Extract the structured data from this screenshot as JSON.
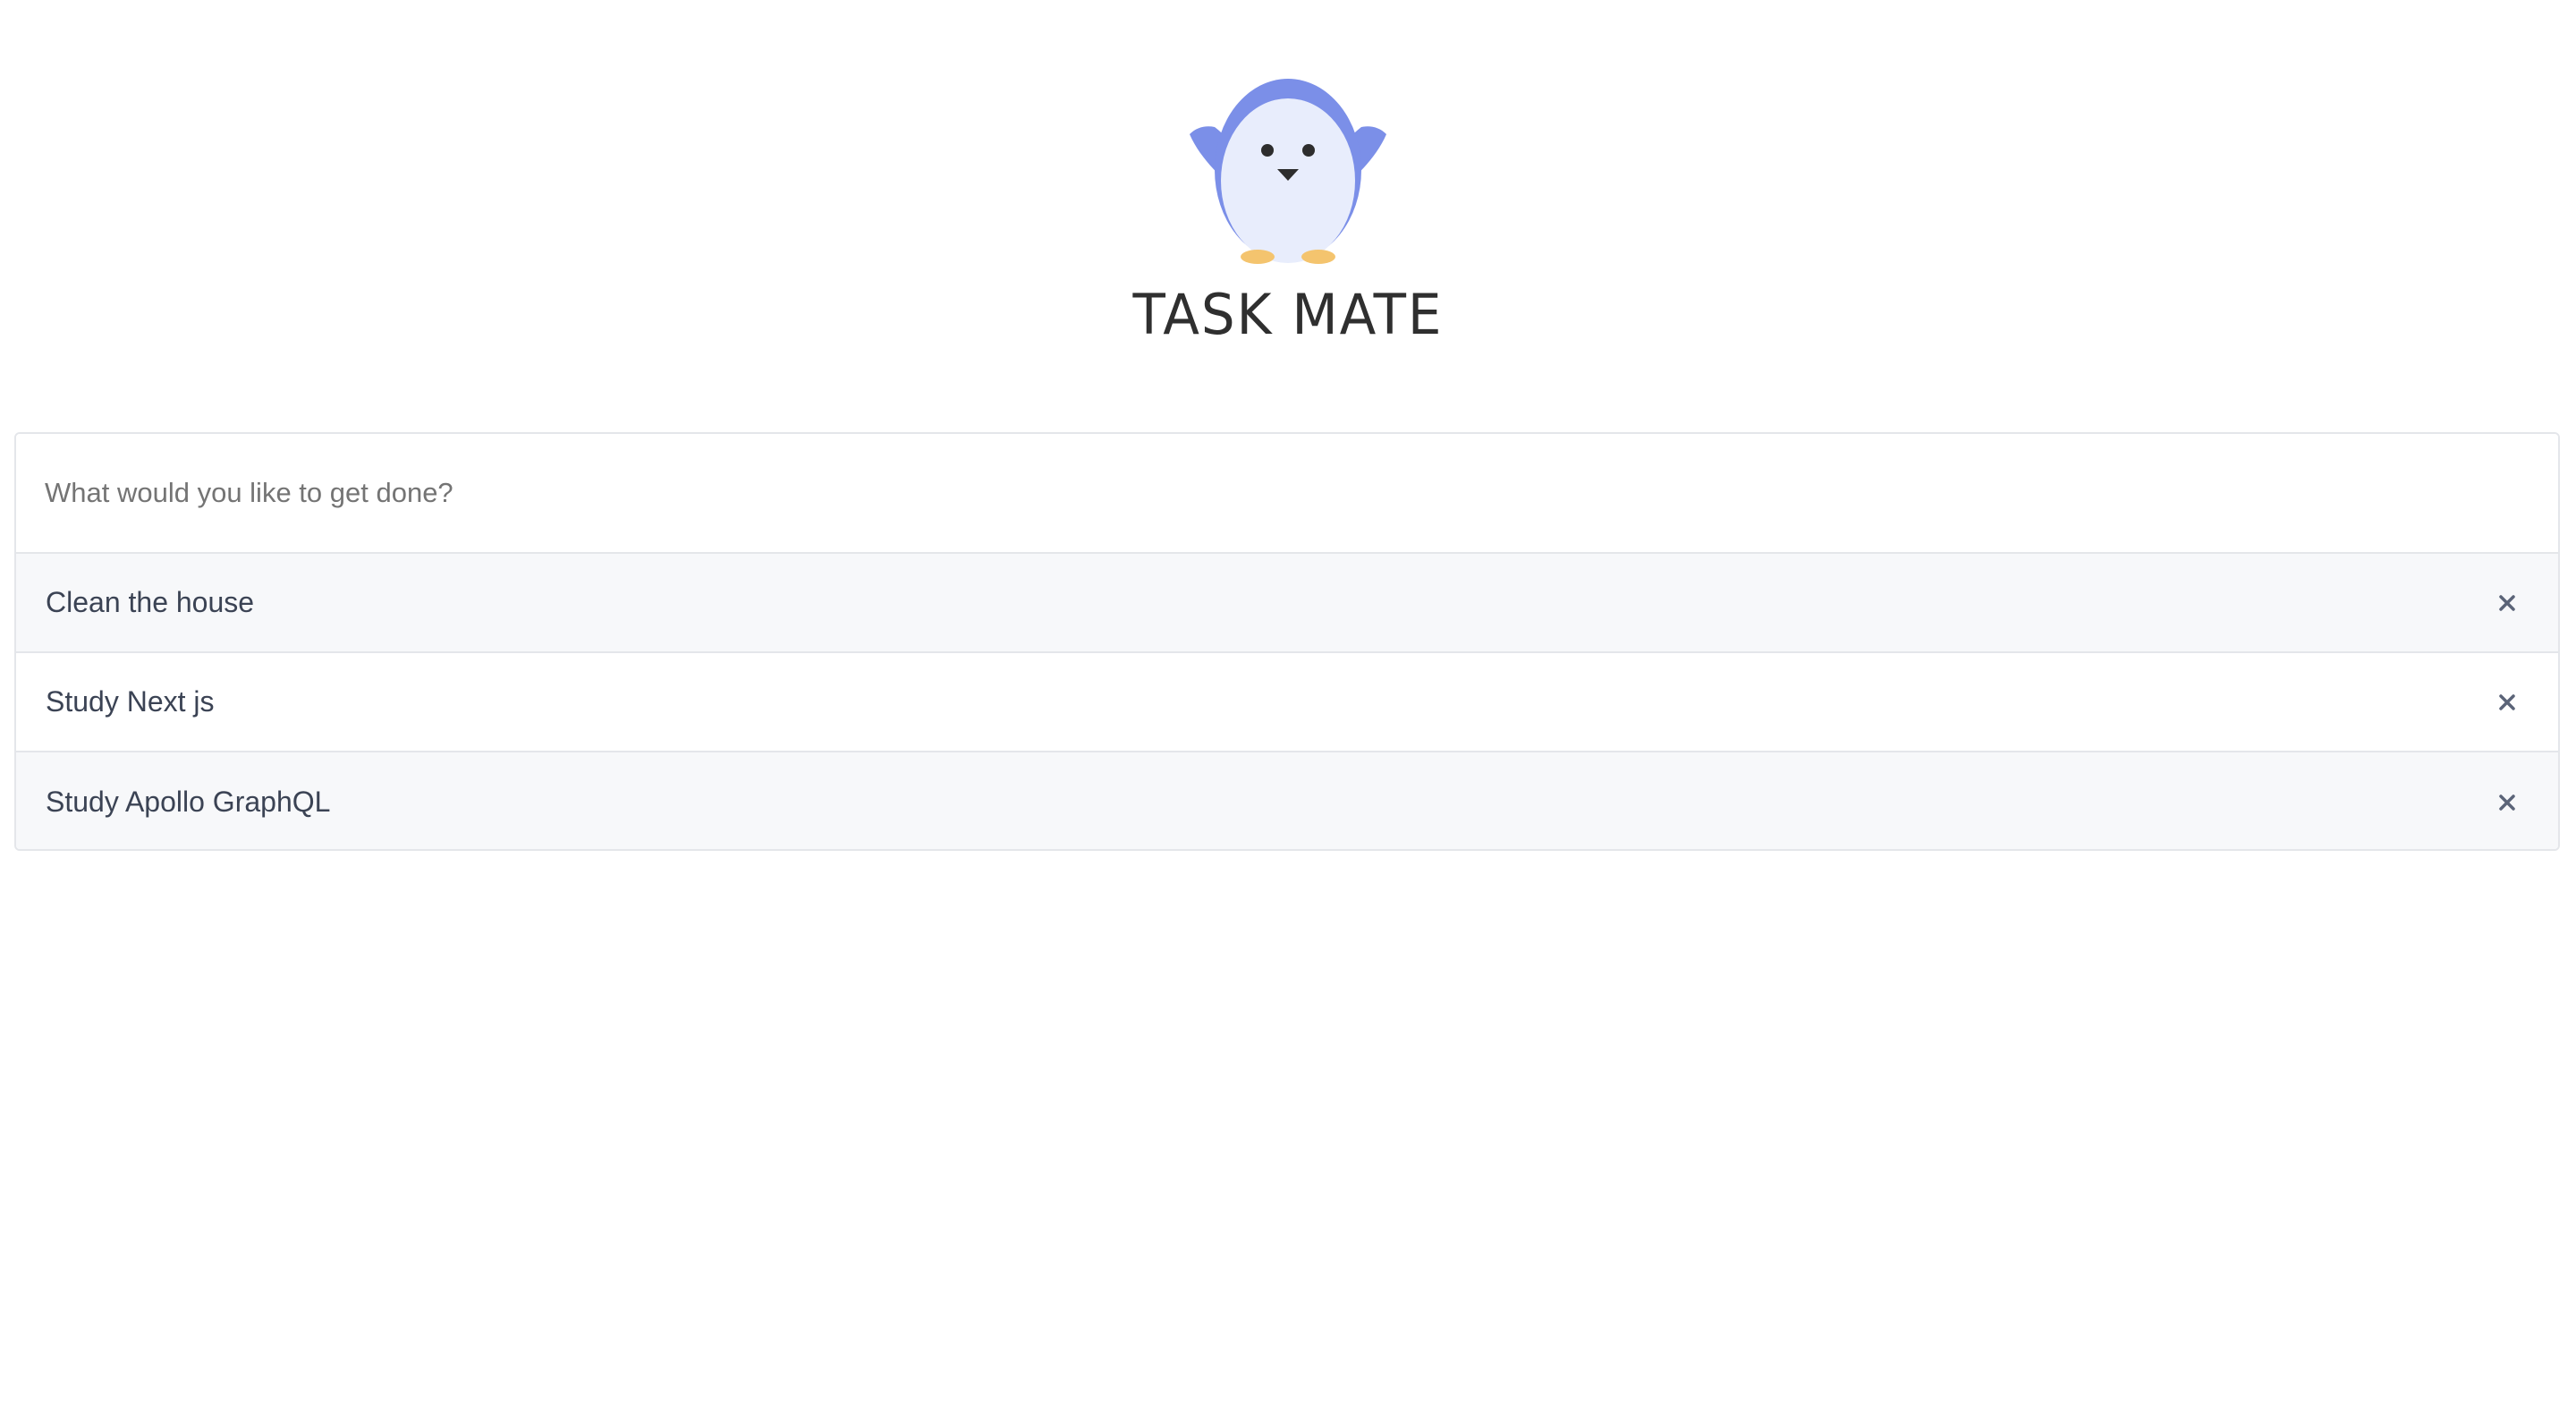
{
  "app": {
    "title": "TASK MATE"
  },
  "logo": {
    "icon": "penguin-icon",
    "colors": {
      "body": "#7b8fe8",
      "belly": "#e8edfc",
      "eyes": "#2d2d2d",
      "feet": "#f4c46e"
    }
  },
  "input": {
    "placeholder": "What would you like to get done?",
    "value": ""
  },
  "tasks": [
    {
      "label": "Clean the house",
      "delete_icon": "close-icon"
    },
    {
      "label": "Study Next js",
      "delete_icon": "close-icon"
    },
    {
      "label": "Study Apollo GraphQL",
      "delete_icon": "close-icon"
    }
  ]
}
